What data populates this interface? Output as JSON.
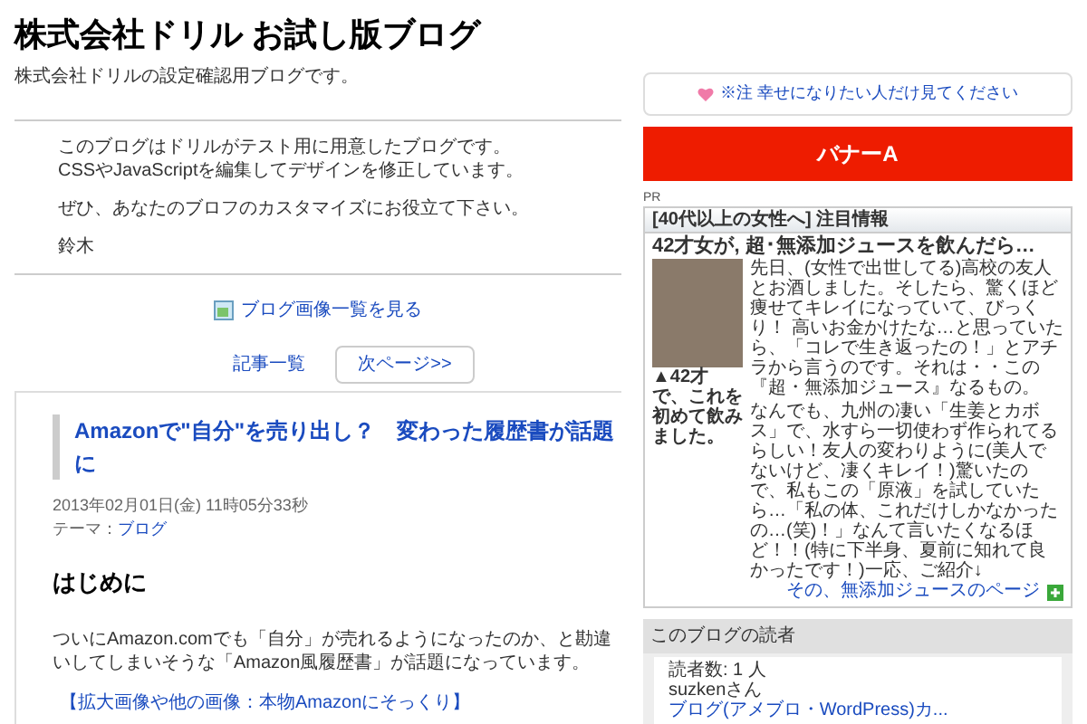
{
  "header": {
    "title": "株式会社ドリル お試し版ブログ",
    "subtitle": "株式会社ドリルの設定確認用ブログです。"
  },
  "intro": {
    "lines": [
      "このブログはドリルがテスト用に用意したブログです。",
      "CSSやJavaScriptを編集してデザインを修正しています。",
      "ぜひ、あなたのブロフのカスタマイズにお役立て下さい。",
      "鈴木"
    ]
  },
  "image_list_link": "ブログ画像一覧を見る",
  "pager": {
    "list_link": "記事一覧",
    "next_button": "次ページ>>"
  },
  "article": {
    "title": "Amazonで\"自分\"を売り出し？　変わった履歴書が話題に",
    "date": "2013年02月01日(金) 11時05分33秒",
    "theme_label": "テーマ：",
    "theme": "ブログ",
    "heading": "はじめに",
    "body": "ついにAmazon.comでも「自分」が売れるようになったのか、と勘違いしてしまいそうな「Amazon風履歴書」が話題になっています。",
    "image_link": "【拡大画像や他の画像：本物Amazonにそっくり】"
  },
  "sidebar": {
    "notice_link": "※注 幸せになりたい人だけ見てください",
    "banner": "バナーA",
    "pr_label": "PR",
    "ad": {
      "header": "[40代以上の女性へ] 注目情報",
      "title": "42才女が, 超･無添加ジュースを飲んだら…",
      "caption": "▲42才で、これを初めて飲みました。",
      "body": "先日、(女性で出世してる)高校の友人とお酒しました。そしたら、驚くほど痩せてキレイになっていて、びっくり！ 高いお金かけたな…と思っていたら、「コレで生き返ったの！」とアチラから言うのです。それは・・この『超・無添加ジュース』なるもの。",
      "body_2": "なんでも、九州の凄い「生姜とカボス」で、水すら一切使わず作られてるらしい！友人の変わりように(美人でないけど、凄くキレイ！)驚いたので、私もこの「原液」を試していたら…「私の体、これだけしかなかったの…(笑)！」なんて言いたくなるほど！！(特に下半身、夏前に知れて良かったです！)一応、ご紹介↓",
      "link": "その、無添加ジュースのページ"
    },
    "readers": {
      "title": "このブログの読者",
      "count": "読者数: 1 人",
      "name": "suzkenさん",
      "blog_link": "ブログ(アメブロ・WordPress)カ..."
    }
  }
}
